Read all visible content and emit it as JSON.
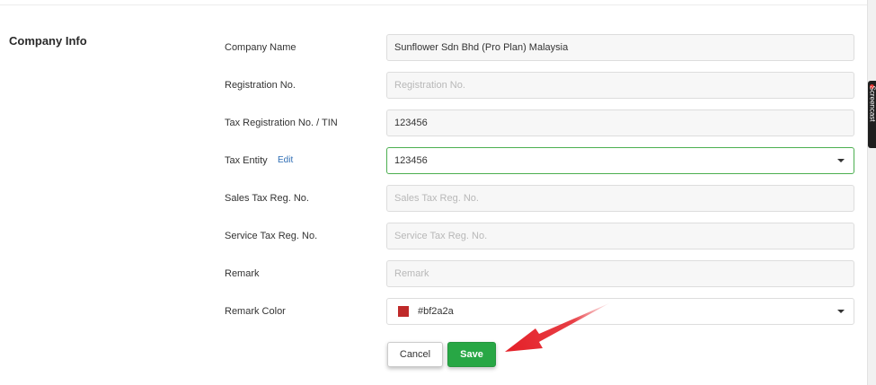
{
  "section": {
    "title": "Company Info"
  },
  "fields": {
    "company_name": {
      "label": "Company Name",
      "value": "Sunflower Sdn Bhd (Pro Plan) Malaysia",
      "placeholder": ""
    },
    "registration_no": {
      "label": "Registration No.",
      "value": "",
      "placeholder": "Registration No."
    },
    "tax_registration_no": {
      "label": "Tax Registration No. / TIN",
      "value": "123456",
      "placeholder": ""
    },
    "tax_entity": {
      "label": "Tax Entity",
      "edit_label": "Edit",
      "value": "123456"
    },
    "sales_tax_reg_no": {
      "label": "Sales Tax Reg. No.",
      "value": "",
      "placeholder": "Sales Tax Reg. No."
    },
    "service_tax_reg_no": {
      "label": "Service Tax Reg. No.",
      "value": "",
      "placeholder": "Service Tax Reg. No."
    },
    "remark": {
      "label": "Remark",
      "value": "",
      "placeholder": "Remark"
    },
    "remark_color": {
      "label": "Remark Color",
      "value": "#bf2a2a",
      "swatch_color": "#bf2a2a"
    }
  },
  "actions": {
    "cancel_label": "Cancel",
    "save_label": "Save"
  },
  "colors": {
    "accent_green": "#28a745",
    "focus_border": "#4caf50",
    "arrow_red": "#e41e26",
    "link_blue": "#2e6db4"
  },
  "badge": {
    "text": "Screencast"
  },
  "icons": {
    "dropdown": "chevron-down-icon",
    "annotation": "arrow-pointer-icon"
  }
}
